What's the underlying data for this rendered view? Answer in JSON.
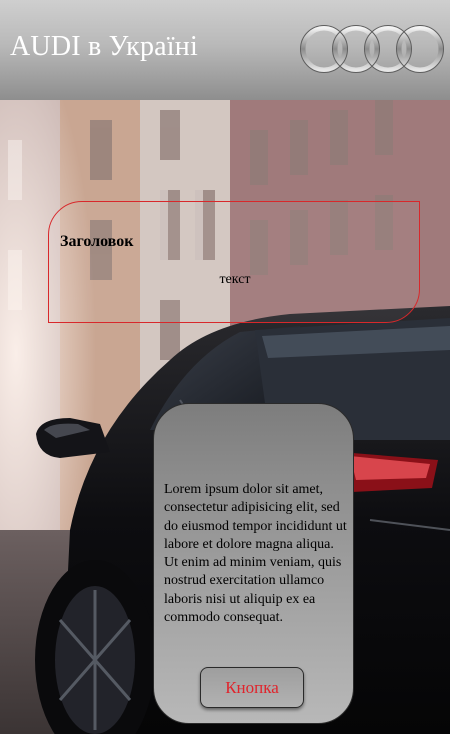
{
  "header": {
    "title": "AUDI в Україні",
    "logo_icon": "audi-four-rings-logo"
  },
  "card": {
    "heading": "Заголовок",
    "text": "текст",
    "border_color": "#d8282b"
  },
  "panel": {
    "body": "Lorem ipsum dolor sit amet, consectetur adipisicing elit, sed do eiusmod tempor incididunt ut labore et dolore magna aliqua. Ut enim ad minim veniam, quis nostrud exercitation ullamco laboris nisi ut aliquip ex ea commodo consequat.",
    "button_label": "Кнопка",
    "button_text_color": "#e0242c"
  },
  "background": {
    "image": "black-audi-car-on-city-street-photo"
  }
}
